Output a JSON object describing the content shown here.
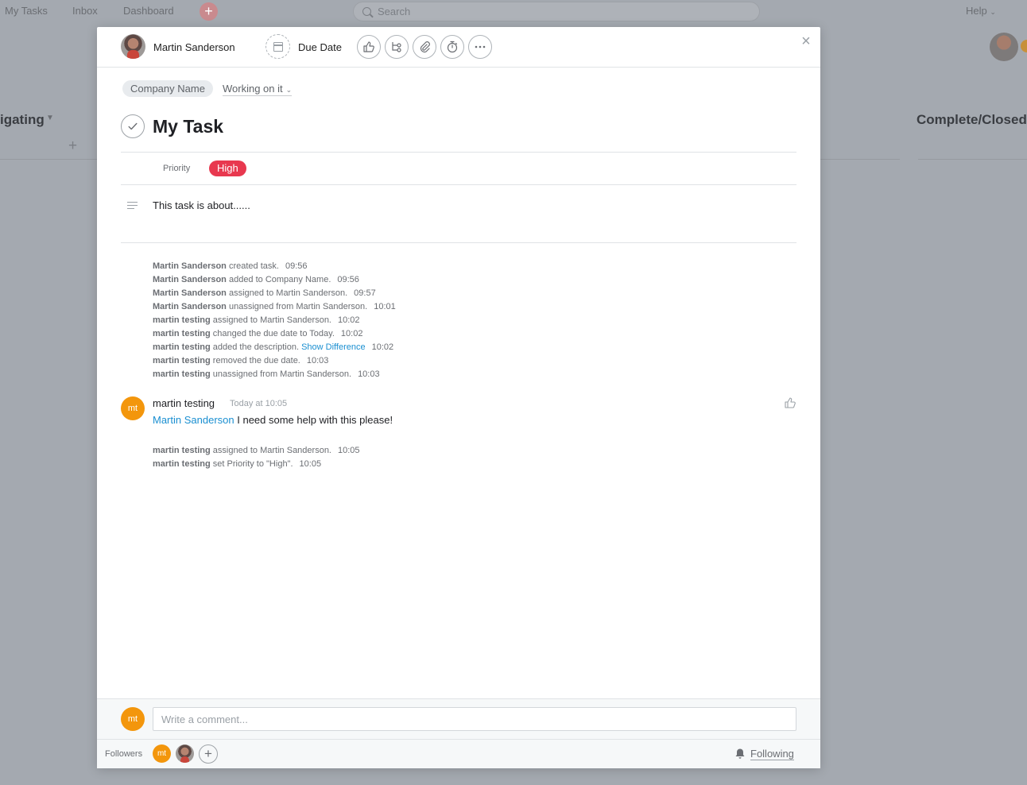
{
  "background": {
    "nav": [
      "My Tasks",
      "Inbox",
      "Dashboard"
    ],
    "search_placeholder": "Search",
    "help": "Help",
    "column_left_title": "igating",
    "column_right_title": "Complete/Closed"
  },
  "header": {
    "assignee": "Martin Sanderson",
    "due_date_label": "Due Date",
    "toolbar_icons": [
      "like-icon",
      "subtask-icon",
      "attach-icon",
      "timer-icon",
      "more-icon"
    ]
  },
  "project": {
    "name": "Company Name",
    "section": "Working on it"
  },
  "task": {
    "title": "My Task",
    "priority_label": "Priority",
    "priority_value": "High",
    "priority_color": "#e8384f",
    "description": "This task is about......"
  },
  "stories": [
    {
      "who": "Martin Sanderson",
      "what": " created task.",
      "time": "09:56"
    },
    {
      "who": "Martin Sanderson",
      "what": " added to Company Name.",
      "time": "09:56"
    },
    {
      "who": "Martin Sanderson",
      "what": " assigned to Martin Sanderson.",
      "time": "09:57"
    },
    {
      "who": "Martin Sanderson",
      "what": " unassigned from Martin Sanderson.",
      "time": "10:01"
    },
    {
      "who": "martin testing",
      "what": " assigned to Martin Sanderson.",
      "time": "10:02"
    },
    {
      "who": "martin testing",
      "what": " changed the due date to Today.",
      "time": "10:02"
    },
    {
      "who": "martin testing",
      "what": " added the description. ",
      "link": "Show Difference",
      "time": "10:02"
    },
    {
      "who": "martin testing",
      "what": " removed the due date.",
      "time": "10:03"
    },
    {
      "who": "martin testing",
      "what": " unassigned from Martin Sanderson.",
      "time": "10:03"
    }
  ],
  "comment": {
    "avatar_initials": "mt",
    "author": "martin testing",
    "time": "Today at 10:05",
    "mention": "Martin Sanderson",
    "text": " I need some help with this please!"
  },
  "stories_after": [
    {
      "who": "martin testing",
      "what": " assigned to Martin Sanderson.",
      "time": "10:05"
    },
    {
      "who": "martin testing",
      "what": " set Priority to \"High\".",
      "time": "10:05"
    }
  ],
  "composer": {
    "avatar_initials": "mt",
    "placeholder": "Write a comment..."
  },
  "followers": {
    "label": "Followers",
    "items": [
      {
        "initials": "mt"
      },
      {
        "initials": ""
      }
    ],
    "following_label": "Following"
  },
  "colors": {
    "accent_orange": "#f3960c",
    "link_blue": "#1a8fd1"
  }
}
